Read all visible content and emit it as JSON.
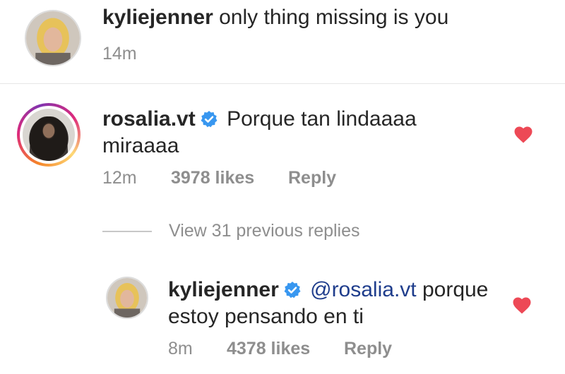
{
  "caption": {
    "username": "kyliejenner",
    "text": "only thing missing is you",
    "time": "14m"
  },
  "comment": {
    "username": "rosalia.vt",
    "verified": true,
    "text_line1": "Porque tan lindaaaa",
    "text_line2": "miraaaa",
    "time": "12m",
    "likes": "3978 likes",
    "reply_label": "Reply",
    "liked": true
  },
  "view_replies_label": "View 31 previous replies",
  "reply": {
    "username": "kyliejenner",
    "verified": true,
    "mention": "@rosalia.vt",
    "text_line1": "porque",
    "text_line2": "estoy pensando en ti",
    "time": "8m",
    "likes": "4378 likes",
    "reply_label": "Reply",
    "liked": true
  },
  "colors": {
    "heart": "#ed4956",
    "verified_badge": "#3897f0",
    "meta_text": "#8e8e8e",
    "mention": "#1f3d8c"
  }
}
